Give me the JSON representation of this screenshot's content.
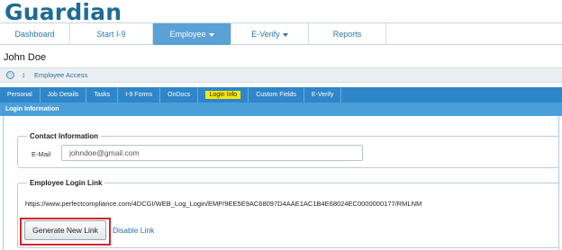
{
  "app": {
    "brand": "Guardian"
  },
  "nav": {
    "items": [
      {
        "label": "Dashboard",
        "active": false,
        "dropdown": false
      },
      {
        "label": "Start I-9",
        "active": false,
        "dropdown": false
      },
      {
        "label": "Employee",
        "active": true,
        "dropdown": true
      },
      {
        "label": "E-Verify",
        "active": false,
        "dropdown": true
      },
      {
        "label": "Reports",
        "active": false,
        "dropdown": false
      }
    ]
  },
  "employee": {
    "name": "John Doe"
  },
  "access_bar": {
    "label": "Employee Access"
  },
  "tabs": [
    {
      "label": "Personal",
      "highlighted": false
    },
    {
      "label": "Job Details",
      "highlighted": false
    },
    {
      "label": "Tasks",
      "highlighted": false
    },
    {
      "label": "I-9 Forms",
      "highlighted": false
    },
    {
      "label": "OnDocs",
      "highlighted": false
    },
    {
      "label": "Login Info",
      "highlighted": true
    },
    {
      "label": "Custom Fields",
      "highlighted": false
    },
    {
      "label": "E-Verify",
      "highlighted": false
    }
  ],
  "section": {
    "title": "Login Information"
  },
  "contact": {
    "legend": "Contact Information",
    "email_label": "E-Mail",
    "email_value": "johndoe@gmail.com"
  },
  "login_link": {
    "legend": "Employee Login Link",
    "url": "https://www.perfectcompliance.com/4DCGI/WEB_Log_Login/EMP/9EE5E9AC68097D4AAE1AC1B4E68024EC0000000177/RMLNM",
    "generate_label": "Generate New Link",
    "disable_label": "Disable Link"
  },
  "colors": {
    "brand": "#1e6c94",
    "nav_active": "#5aa1d6",
    "tab_bar": "#2f86c8",
    "highlight": "#ffe800",
    "annotation_box": "#d8232a"
  }
}
